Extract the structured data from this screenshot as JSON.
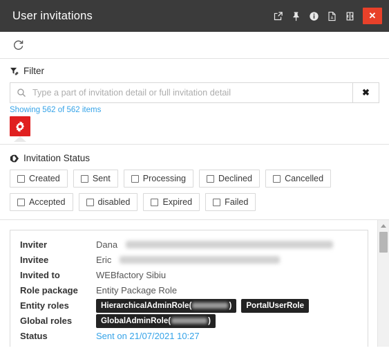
{
  "window": {
    "title": "User invitations",
    "actions": [
      {
        "name": "popout-icon",
        "label": "Open in new window"
      },
      {
        "name": "pin-icon",
        "label": "Pin"
      },
      {
        "name": "info-icon",
        "label": "Info"
      },
      {
        "name": "pdf-icon",
        "label": "Export PDF"
      },
      {
        "name": "maximize-icon",
        "label": "Maximize"
      }
    ],
    "close_label": "✕"
  },
  "toolbar": {
    "refresh_label": "Refresh"
  },
  "filter": {
    "heading": "Filter",
    "search_value": "",
    "search_placeholder": "Type a part of invitation detail or full invitation detail",
    "clear_label": "✖",
    "showing_text": "Showing 562 of 562 items",
    "settings_label": "Settings"
  },
  "invitation_status": {
    "heading": "Invitation Status",
    "options": [
      {
        "label": "Created",
        "checked": false
      },
      {
        "label": "Sent",
        "checked": false
      },
      {
        "label": "Processing",
        "checked": false
      },
      {
        "label": "Declined",
        "checked": false
      },
      {
        "label": "Cancelled",
        "checked": false
      },
      {
        "label": "Accepted",
        "checked": false
      },
      {
        "label": "disabled",
        "checked": false
      },
      {
        "label": "Expired",
        "checked": false
      },
      {
        "label": "Failed",
        "checked": false
      }
    ]
  },
  "detail": {
    "rows": [
      {
        "label": "Inviter",
        "value": "Dana",
        "redacted_width": 300
      },
      {
        "label": "Invitee",
        "value": "Eric",
        "redacted_width": 232
      },
      {
        "label": "Invited to",
        "value": "WEBfactory Sibiu",
        "redacted_width": 0
      },
      {
        "label": "Role package",
        "value": "Entity Package Role",
        "redacted_width": 0
      }
    ],
    "entity_roles_label": "Entity roles",
    "entity_roles": [
      {
        "prefix": "HierarchicalAdminRole(",
        "redacted": true,
        "suffix": ")"
      },
      {
        "prefix": "PortalUserRole",
        "redacted": false,
        "suffix": ""
      }
    ],
    "global_roles_label": "Global roles",
    "global_roles": [
      {
        "prefix": "GlobalAdminRole(",
        "redacted": true,
        "suffix": ")"
      }
    ],
    "status_label": "Status",
    "status_value": "Sent on 21/07/2021 10:27"
  },
  "colors": {
    "titlebar_bg": "#3b3b3b",
    "close_red": "#e8412a",
    "gear_red": "#e02020",
    "link_blue": "#35a3e8",
    "badge_dark": "#232323"
  }
}
